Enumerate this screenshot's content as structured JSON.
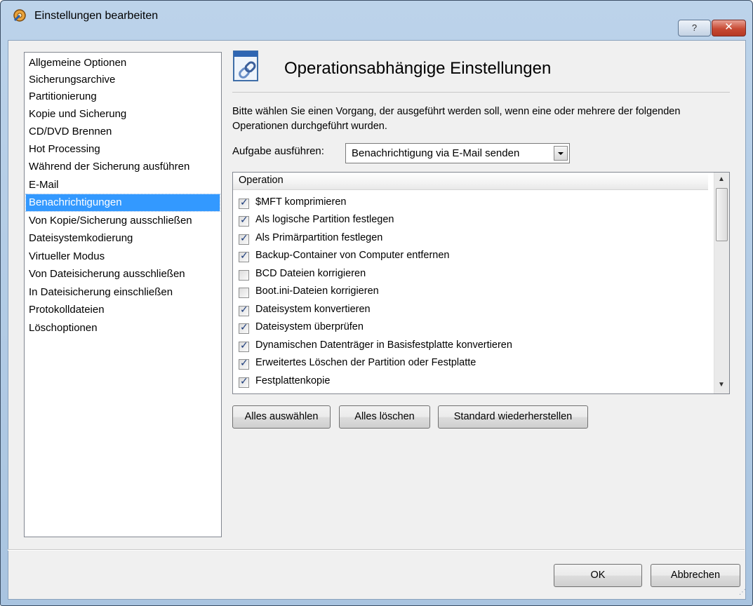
{
  "window": {
    "title": "Einstellungen bearbeiten",
    "help_label": "?",
    "close_label": "✕"
  },
  "sidebar": {
    "items": [
      {
        "label": "Allgemeine Optionen"
      },
      {
        "label": "Sicherungsarchive"
      },
      {
        "label": "Partitionierung"
      },
      {
        "label": "Kopie und Sicherung"
      },
      {
        "label": "CD/DVD Brennen"
      },
      {
        "label": "Hot Processing"
      },
      {
        "label": "Während der Sicherung ausführen"
      },
      {
        "label": "E-Mail"
      },
      {
        "label": "Benachrichtigungen",
        "selected": true
      },
      {
        "label": "Von Kopie/Sicherung ausschließen"
      },
      {
        "label": "Dateisystemkodierung"
      },
      {
        "label": "Virtueller Modus"
      },
      {
        "label": "Von Dateisicherung ausschließen"
      },
      {
        "label": "In Dateisicherung einschließen"
      },
      {
        "label": "Protokolldateien"
      },
      {
        "label": "Löschoptionen"
      }
    ]
  },
  "main": {
    "title": "Operationsabhängige Einstellungen",
    "description": "Bitte wählen Sie einen Vorgang, der ausgeführt werden soll, wenn eine oder mehrere der folgenden Operationen durchgeführt wurden.",
    "task_label": "Aufgabe ausführen:",
    "task_value": "Benachrichtigung via E-Mail senden",
    "list_header": "Operation",
    "operations": [
      {
        "label": "$MFT komprimieren",
        "checked": true
      },
      {
        "label": "Als logische Partition festlegen",
        "checked": true
      },
      {
        "label": "Als Primärpartition festlegen",
        "checked": true
      },
      {
        "label": "Backup-Container von Computer entfernen",
        "checked": true
      },
      {
        "label": "BCD Dateien korrigieren",
        "checked": false
      },
      {
        "label": "Boot.ini-Dateien korrigieren",
        "checked": false
      },
      {
        "label": "Dateisystem konvertieren",
        "checked": true
      },
      {
        "label": "Dateisystem überprüfen",
        "checked": true
      },
      {
        "label": "Dynamischen Datenträger in Basisfestplatte konvertieren",
        "checked": true
      },
      {
        "label": "Erweitertes Löschen der Partition oder Festplatte",
        "checked": true
      },
      {
        "label": "Festplattenkopie",
        "checked": true
      }
    ],
    "buttons": {
      "select_all": "Alles auswählen",
      "clear_all": "Alles löschen",
      "restore_default": "Standard wiederherstellen"
    }
  },
  "footer": {
    "ok": "OK",
    "cancel": "Abbrechen"
  },
  "icons": {
    "title": "settings-icon",
    "header": "link-document-icon",
    "checkbox": "checkmark-icon"
  },
  "colors": {
    "selection": "#3399ff",
    "title_bar": "#bcd3ea",
    "close_button": "#c74a34"
  }
}
